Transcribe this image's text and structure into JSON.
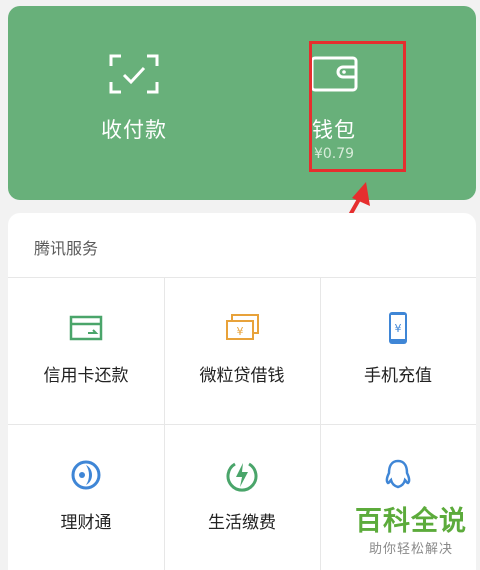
{
  "top": {
    "pay_label": "收付款",
    "wallet_label": "钱包",
    "wallet_balance": "¥0.79"
  },
  "services": {
    "title": "腾讯服务",
    "items": [
      {
        "label": "信用卡还款",
        "icon": "credit-card-icon"
      },
      {
        "label": "微粒贷借钱",
        "icon": "cash-notes-icon"
      },
      {
        "label": "手机充值",
        "icon": "phone-recharge-icon"
      },
      {
        "label": "理财通",
        "icon": "wealth-icon"
      },
      {
        "label": "生活缴费",
        "icon": "utility-bolt-icon"
      },
      {
        "label": "",
        "icon": "qq-icon"
      }
    ]
  },
  "watermark": {
    "brand": "百科全说",
    "slogan": "助你轻松解决"
  },
  "colors": {
    "card_green": "#68b07a",
    "highlight_red": "#e62e2e",
    "icon_green": "#4aa56a",
    "icon_orange": "#e8a23a",
    "icon_blue": "#3f86d6"
  }
}
